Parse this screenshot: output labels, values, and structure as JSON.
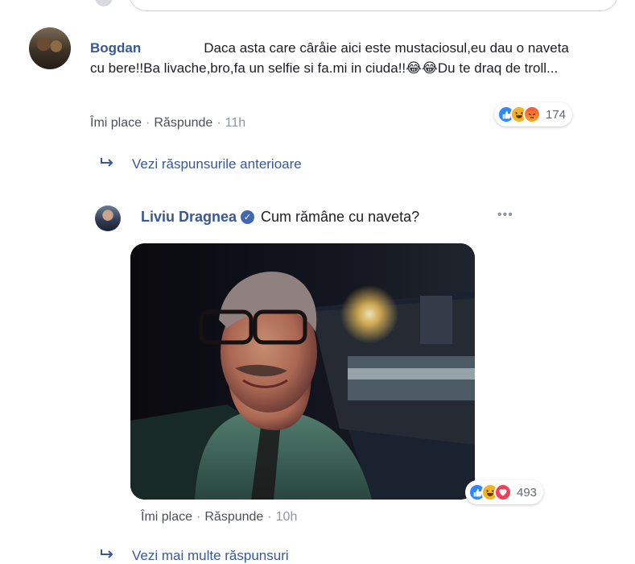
{
  "comment1": {
    "author": "Bogdan",
    "text_part1": "Daca asta care câråie aici este mustaciosul,eu dau o naveta cu bere!!Ba livache,bro,fa un selfie si fa.mi in ciuda!!",
    "emoji": "😂😂",
    "text_part2": "Du te draq de troll...",
    "like_label": "Îmi place",
    "reply_label": "Răspunde",
    "time": "11h",
    "reaction_count": "174",
    "reaction_icons": [
      "like",
      "haha",
      "angry"
    ]
  },
  "previous_replies_label": "Vezi răspunsurile anterioare",
  "reply1": {
    "author": "Liviu Dragnea",
    "verified_icon": "verified-badge-icon",
    "text": "Cum rămâne cu naveta?",
    "more_icon": "more-options-icon",
    "like_label": "Îmi place",
    "reply_label": "Răspunde",
    "time": "10h",
    "reaction_count": "493",
    "reaction_icons": [
      "like",
      "haha",
      "love"
    ]
  },
  "more_replies_label": "Vezi mai multe răspunsuri",
  "colors": {
    "link_blue": "#385898",
    "meta_gray": "#90949c",
    "like_blue": "#2d88ff",
    "love_red": "#f33e58"
  }
}
